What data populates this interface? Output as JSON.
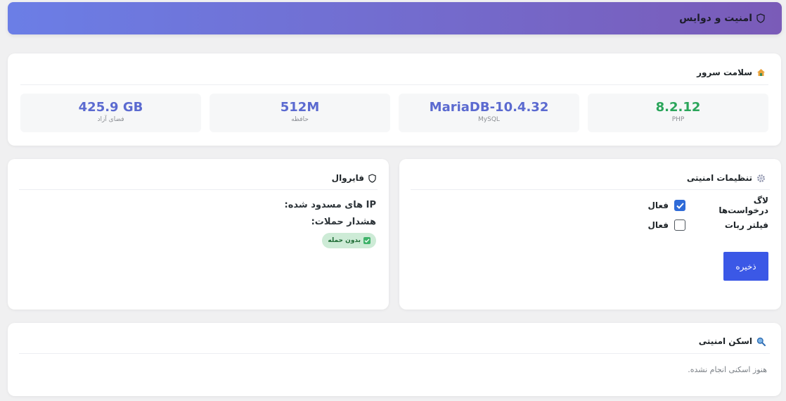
{
  "header": {
    "title": "امنیت و دوایس",
    "icon": "shield-icon"
  },
  "health": {
    "title": "سلامت سرور",
    "icon": "house-icon",
    "stats": [
      {
        "value": "8.2.12",
        "label": "PHP",
        "color": "#2aa55a"
      },
      {
        "value": "MariaDB-10.4.32",
        "label": "MySQL",
        "color": "#5b6ad0"
      },
      {
        "value": "512M",
        "label": "حافظه",
        "color": "#5b6ad0"
      },
      {
        "value": "425.9 GB",
        "label": "فضای آزاد",
        "color": "#5b6ad0"
      }
    ]
  },
  "settings": {
    "title": "تنظیمات امنیتی",
    "icon": "gear-icon",
    "rows": [
      {
        "name": "لاگ درخواست‌ها",
        "checked": true,
        "state": "فعال"
      },
      {
        "name": "فیلتر ربات",
        "checked": false,
        "state": "فعال"
      }
    ],
    "save_label": "ذخیره"
  },
  "firewall": {
    "title": "فایروال",
    "icon": "shield-icon",
    "blocked_label": "IP های مسدود شده:",
    "attacks_label": "هشدار حملات:",
    "badge": "بدون حمله"
  },
  "scan": {
    "title": "اسکن امنیتی",
    "icon": "search-icon",
    "message": "هنوز اسکنی انجام نشده."
  },
  "colors": {
    "accent": "#3b58e6",
    "gradient_start": "#6b7ee6",
    "gradient_end": "#7a5bb8"
  }
}
